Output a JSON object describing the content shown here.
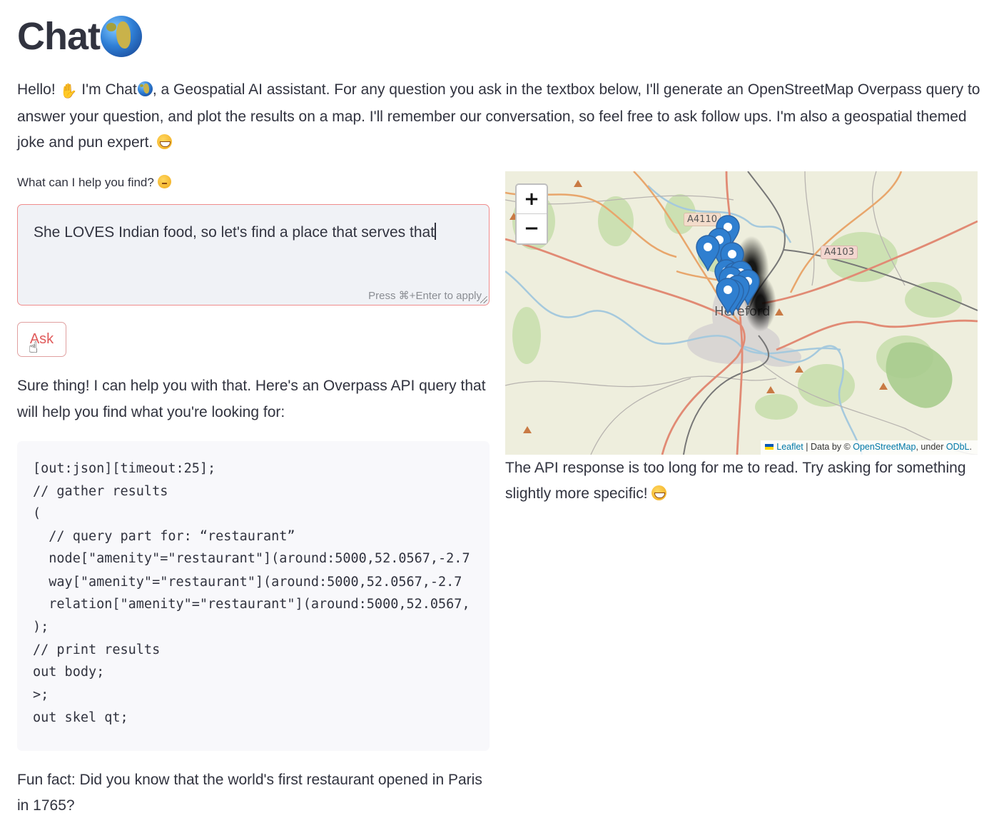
{
  "app": {
    "title": "Chat"
  },
  "intro": {
    "part1": "Hello! ",
    "part2": " I'm Chat",
    "part3": ", a Geospatial AI assistant. For any question you ask in the textbox below, I'll generate an OpenStreetMap Overpass query to answer your question, and plot the results on a map. I'll remember our conversation, so feel free to ask follow ups. I'm also a geospatial themed joke and pun expert. "
  },
  "input": {
    "label": "What can I help you find? ",
    "value": "She LOVES Indian food, so let's find a place that serves that",
    "hint": "Press ⌘+Enter to apply"
  },
  "ask_button": {
    "label": "Ask"
  },
  "response": {
    "text": "Sure thing! I can help you with that. Here's an Overpass API query that will help you find what you're looking for:",
    "code_lines": [
      "[out:json][timeout:25];",
      "// gather results",
      "(",
      "  // query part for: “restaurant”",
      "  node[\"amenity\"=\"restaurant\"](around:5000,52.0567,-2.7",
      "  way[\"amenity\"=\"restaurant\"](around:5000,52.0567,-2.7",
      "  relation[\"amenity\"=\"restaurant\"](around:5000,52.0567,",
      ");",
      "// print results",
      "out body;",
      ">;",
      "out skel qt;"
    ],
    "fun_fact": "Fun fact: Did you know that the world's first restaurant opened in Paris in 1765?"
  },
  "map": {
    "zoom_in_label": "+",
    "zoom_out_label": "−",
    "road_labels": [
      "A4110",
      "A4103"
    ],
    "place_label": "Hereford",
    "attribution": {
      "leaflet": "Leaflet",
      "data_by": " | Data by © ",
      "osm": "OpenStreetMap",
      "under": ", under ",
      "odbl": "ODbL",
      "end": "."
    },
    "marker_color": "#2f7fd0"
  },
  "map_response": {
    "text": "The API response is too long for me to read. Try asking for something slightly more specific! "
  }
}
